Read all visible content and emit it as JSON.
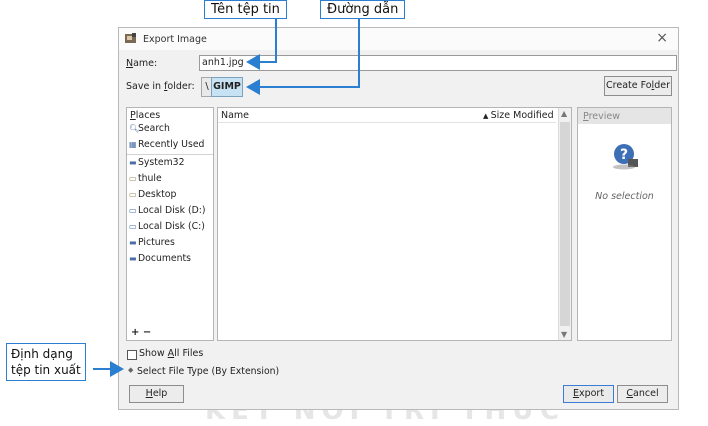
{
  "annotations": {
    "file_name_label": "Tên tệp tin",
    "path_label": "Đường dẫn",
    "format_label_line1": "Định dạng",
    "format_label_line2": "tệp tin xuất"
  },
  "watermark_text": "KẾT NỐI TRI THỨC",
  "dialog": {
    "title": "Export Image",
    "close_icon": "close-icon",
    "name": {
      "label_prefix": "N",
      "label_rest": "ame:",
      "value": "anh1.jpg"
    },
    "save_in": {
      "label_pre": "Save in ",
      "label_u": "f",
      "label_post": "older:",
      "separator": "\\",
      "folder": "GIMP"
    },
    "create_folder": {
      "pre": "Create Fo",
      "u": "l",
      "post": "der"
    },
    "places": {
      "header_u": "P",
      "header_rest": "laces",
      "items": [
        {
          "icon": "search-icon",
          "label": "Search"
        },
        {
          "icon": "recent-icon",
          "label": "Recently Used"
        },
        {
          "icon": "folder-icon",
          "label": "System32"
        },
        {
          "icon": "folder-icon",
          "label": "thule"
        },
        {
          "icon": "desktop-icon",
          "label": "Desktop"
        },
        {
          "icon": "drive-icon",
          "label": "Local Disk (D:)"
        },
        {
          "icon": "drive-icon",
          "label": "Local Disk (C:)"
        },
        {
          "icon": "pictures-icon",
          "label": "Pictures"
        },
        {
          "icon": "documents-icon",
          "label": "Documents"
        }
      ],
      "add_remove": "+ −"
    },
    "files": {
      "col_name": "Name",
      "col_size_modified": "Size Modified"
    },
    "preview": {
      "title_u": "P",
      "title_rest": "review",
      "no_selection": "No selection"
    },
    "show_all_files": {
      "pre": "Show ",
      "u": "A",
      "post": "ll Files"
    },
    "select_file_type": "Select File Type (By Extension)",
    "help": {
      "u": "H",
      "rest": "elp"
    },
    "export": {
      "u": "E",
      "rest": "xport"
    },
    "cancel": {
      "u": "C",
      "rest": "ancel"
    },
    "colors": {
      "accent": "#2a7fd0",
      "path_button": "#c7e2f3"
    }
  }
}
